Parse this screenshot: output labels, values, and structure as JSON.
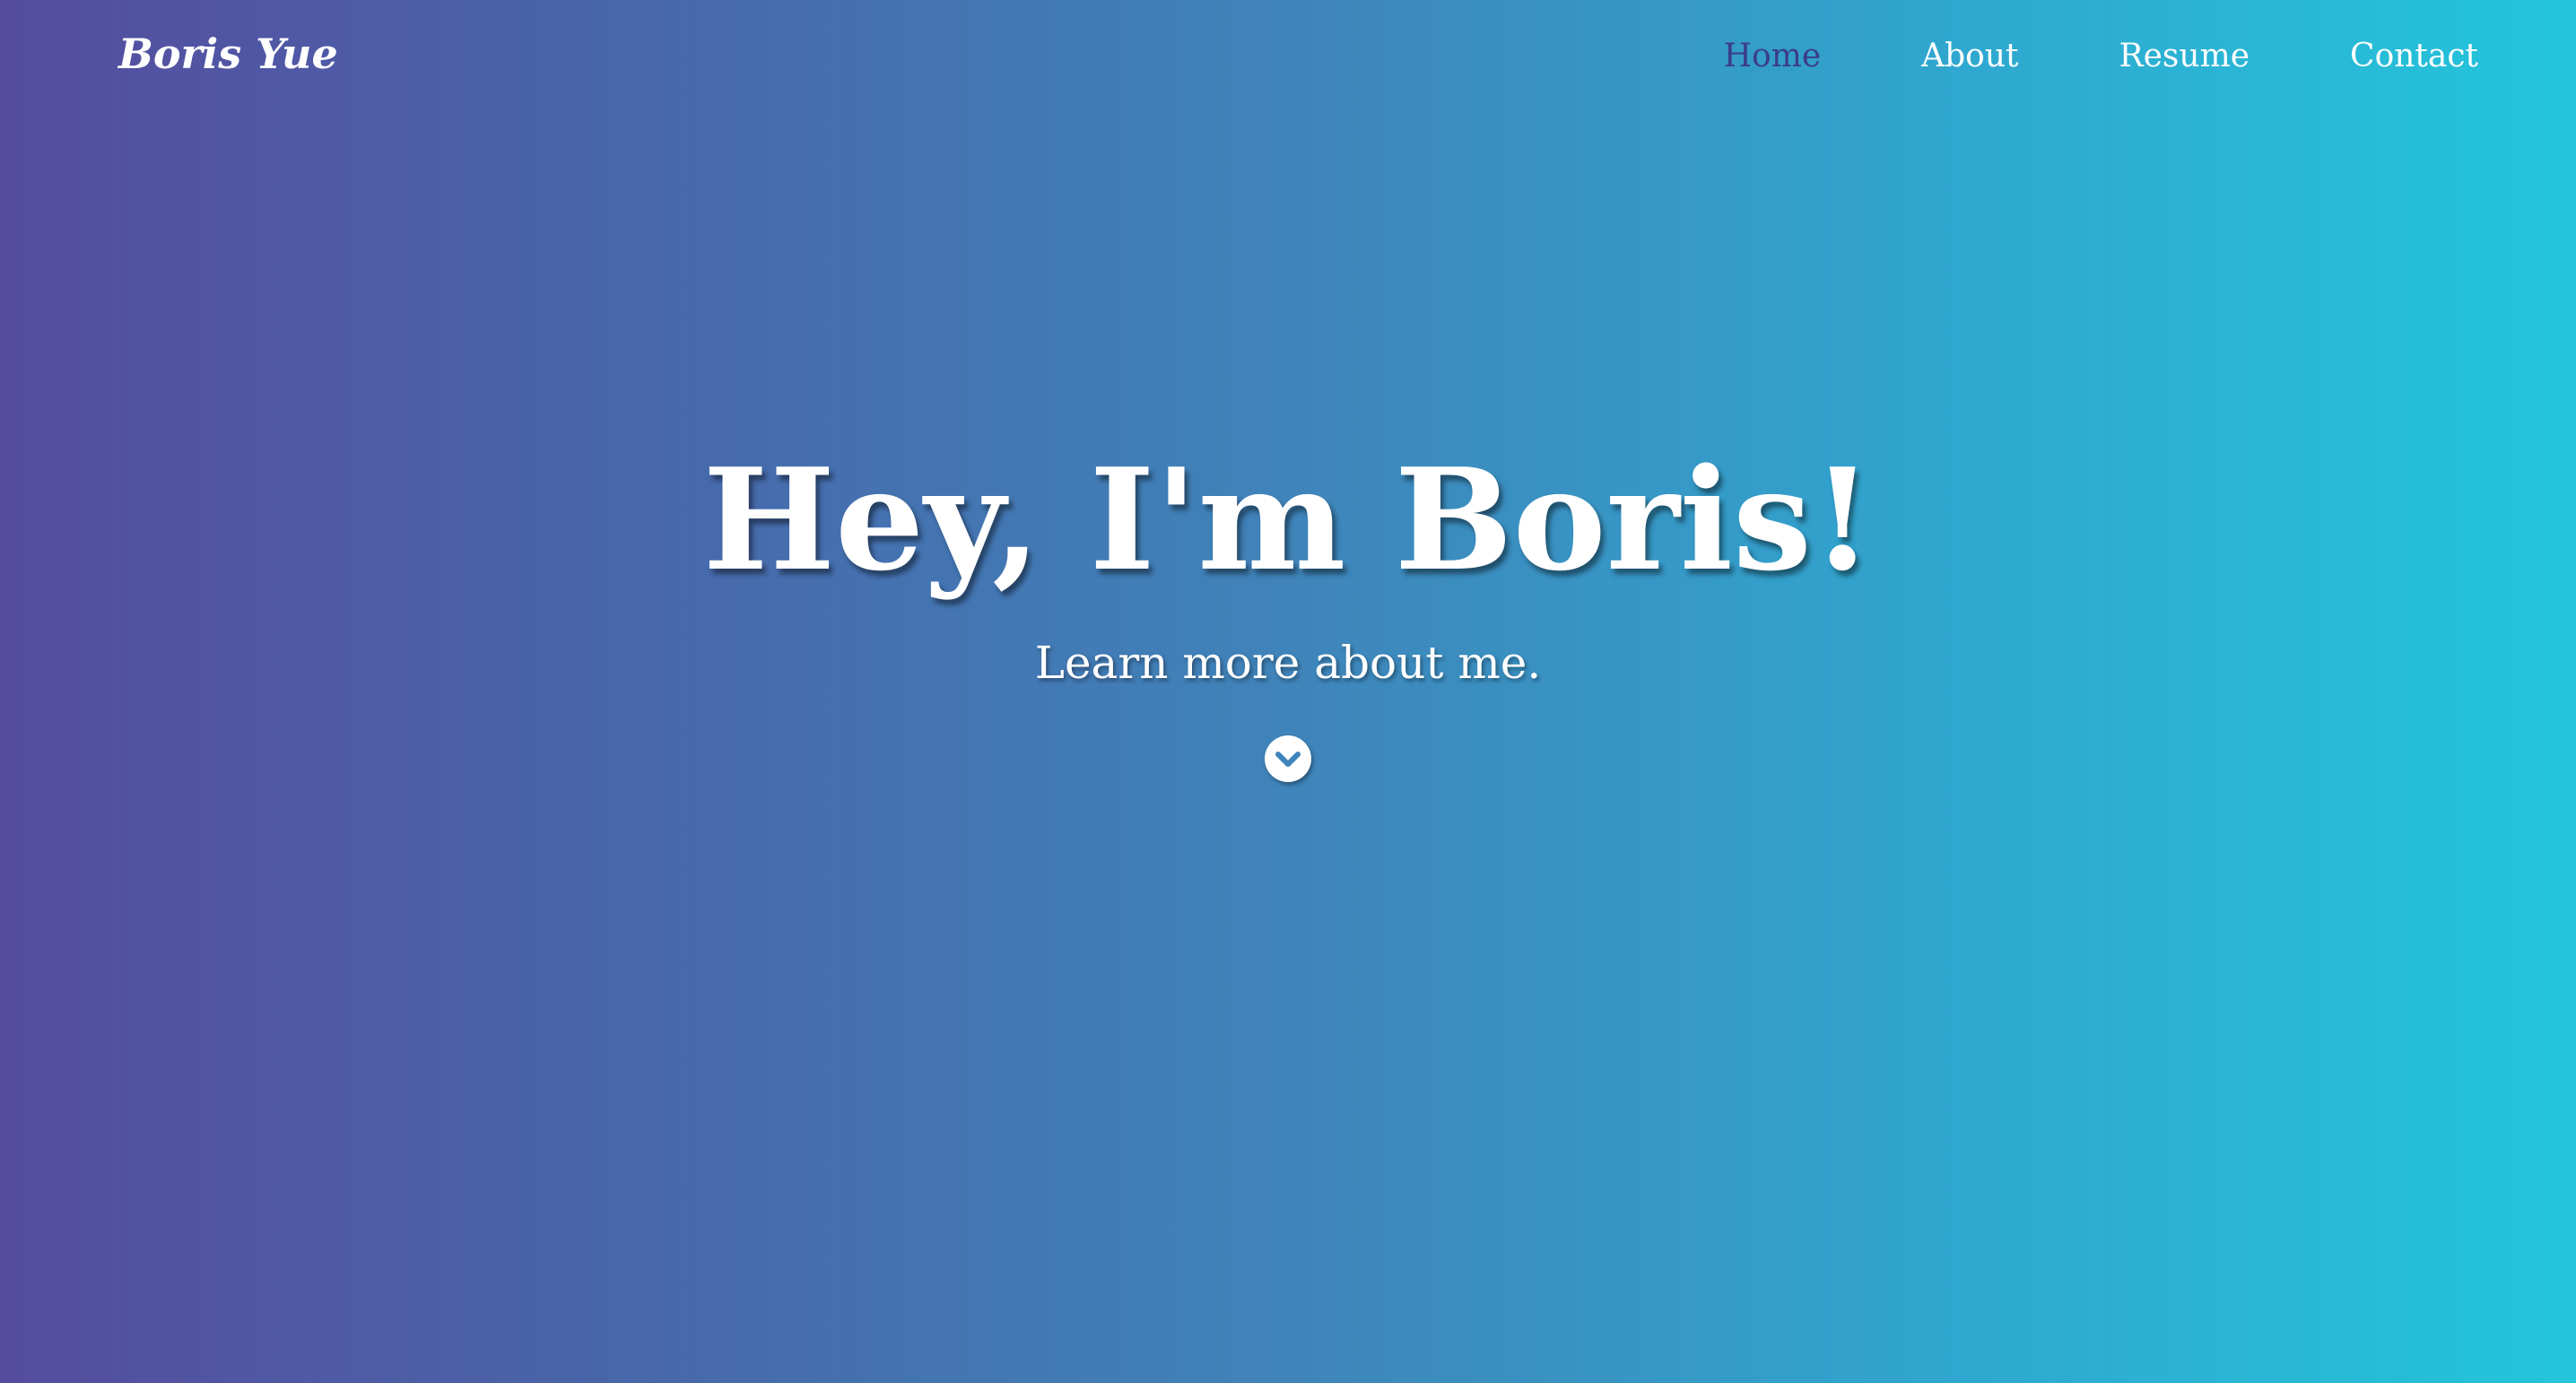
{
  "header": {
    "brand": "Boris Yue",
    "nav": [
      {
        "label": "Home",
        "active": true
      },
      {
        "label": "About",
        "active": false
      },
      {
        "label": "Resume",
        "active": false
      },
      {
        "label": "Contact",
        "active": false
      }
    ]
  },
  "hero": {
    "title": "Hey, I'm Boris!",
    "subtitle": "Learn more about me.",
    "scroll_icon": "chevron-down-circle-icon"
  },
  "colors": {
    "gradient_start": "#554c9f",
    "gradient_end": "#23c5dc",
    "active_nav": "#3b3c8c",
    "text": "#ffffff"
  }
}
